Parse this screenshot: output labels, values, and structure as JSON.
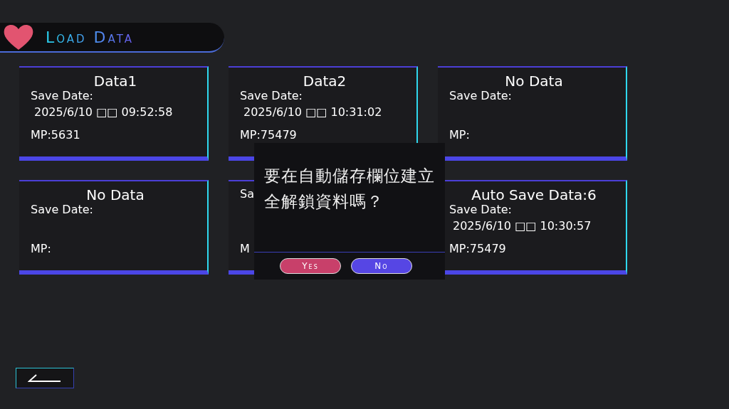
{
  "header": {
    "title": "Load Data"
  },
  "slots": [
    {
      "title": "Data1",
      "date_label": "Save Date:",
      "date": "2025/6/10 □□ 09:52:58",
      "mp": "MP:5631"
    },
    {
      "title": "Data2",
      "date_label": "Save Date:",
      "date": "2025/6/10 □□ 10:31:02",
      "mp": "MP:75479"
    },
    {
      "title": "No Data",
      "date_label": "Save Date:",
      "mp": "MP:"
    },
    {
      "title": "No Data",
      "date_label": "Save Date:",
      "mp": "MP:"
    },
    {
      "date_label": "Sa",
      "mp": "M"
    },
    {
      "title": "Auto Save Data:6",
      "date_label": "Save Date:",
      "date": "2025/6/10 □□ 10:30:57",
      "mp": "MP:75479"
    }
  ],
  "dialog": {
    "message": "要在自動儲存欄位建立全解鎖資料嗎？",
    "buttons": [
      {
        "label": "Yes",
        "kind": "confirm"
      },
      {
        "label": "No",
        "kind": "cancel"
      }
    ]
  }
}
